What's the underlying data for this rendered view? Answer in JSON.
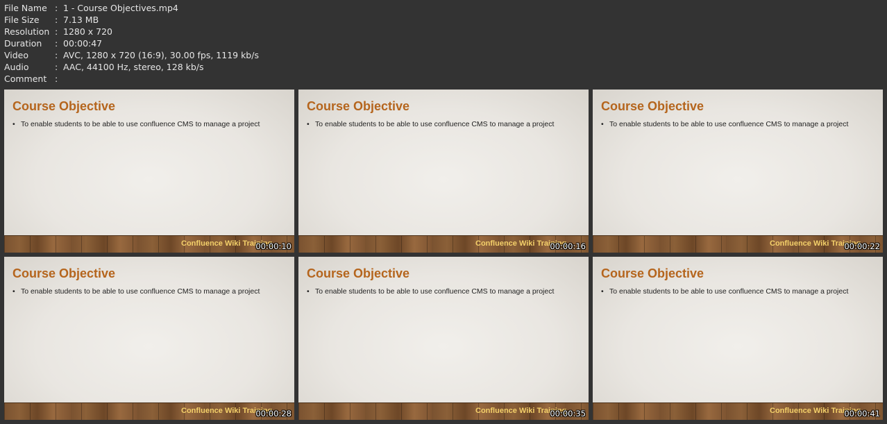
{
  "file_info": [
    {
      "label": "File Name",
      "sep": ":",
      "value": "1 - Course Objectives.mp4"
    },
    {
      "label": "File Size",
      "sep": ":",
      "value": "7.13 MB"
    },
    {
      "label": "Resolution",
      "sep": ":",
      "value": "1280 x 720"
    },
    {
      "label": "Duration",
      "sep": ":",
      "value": "00:00:47"
    },
    {
      "label": "Video",
      "sep": ":",
      "value": "AVC, 1280 x 720 (16:9), 30.00 fps, 1119 kb/s"
    },
    {
      "label": "Audio",
      "sep": ":",
      "value": "AAC, 44100 Hz, stereo, 128 kb/s"
    },
    {
      "label": "Comment",
      "sep": ":",
      "value": ""
    }
  ],
  "thumbnails": [
    {
      "slide_title": "Course Objective",
      "bullet_mark": "•",
      "bullet": "To enable students to be able to use confluence CMS to manage a project",
      "brand": "Confluence Wiki Training",
      "timestamp": "00:00:10"
    },
    {
      "slide_title": "Course Objective",
      "bullet_mark": "•",
      "bullet": "To enable students to be able to use confluence CMS to manage a project",
      "brand": "Confluence Wiki Training",
      "timestamp": "00:00:16"
    },
    {
      "slide_title": "Course Objective",
      "bullet_mark": "•",
      "bullet": "To enable students to be able to use confluence CMS to manage a project",
      "brand": "Confluence Wiki Training",
      "timestamp": "00:00:22"
    },
    {
      "slide_title": "Course Objective",
      "bullet_mark": "•",
      "bullet": "To enable students to be able to use confluence CMS to manage a project",
      "brand": "Confluence Wiki Training",
      "timestamp": "00:00:28"
    },
    {
      "slide_title": "Course Objective",
      "bullet_mark": "•",
      "bullet": "To enable students to be able to use confluence CMS to manage a project",
      "brand": "Confluence Wiki Training",
      "timestamp": "00:00:35"
    },
    {
      "slide_title": "Course Objective",
      "bullet_mark": "•",
      "bullet": "To enable students to be able to use confluence CMS to manage a project",
      "brand": "Confluence Wiki Training",
      "timestamp": "00:00:41"
    }
  ],
  "colors": {
    "background": "#333333",
    "info_text": "#e6e6e6",
    "slide_title": "#b5651d",
    "brand_text": "#f4d06a",
    "timestamp_text": "#ffffff"
  }
}
